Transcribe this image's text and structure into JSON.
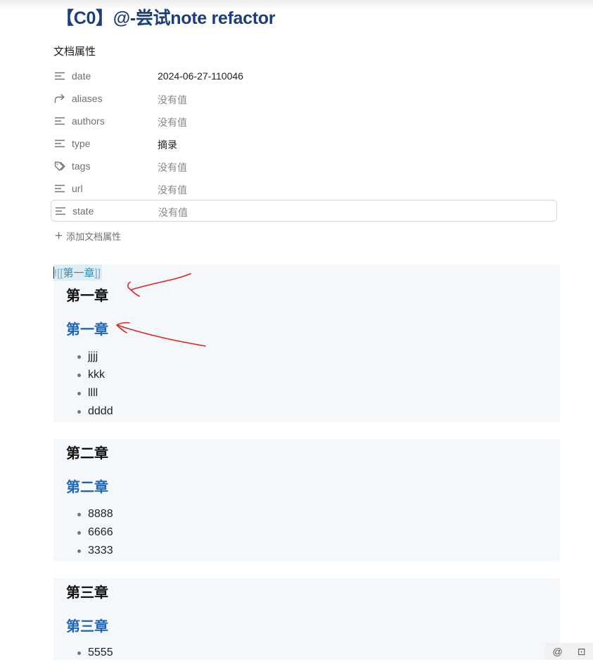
{
  "page": {
    "title": "【C0】@-尝试note refactor"
  },
  "properties": {
    "heading": "文档属性",
    "rows": [
      {
        "key": "date",
        "value": "2024-06-27-110046",
        "icon": "text-lines-icon",
        "empty": false
      },
      {
        "key": "aliases",
        "value": "没有值",
        "icon": "forward-arrow-icon",
        "empty": true
      },
      {
        "key": "authors",
        "value": "没有值",
        "icon": "text-lines-icon",
        "empty": true
      },
      {
        "key": "type",
        "value": "摘录",
        "icon": "text-lines-icon",
        "empty": false
      },
      {
        "key": "tags",
        "value": "没有值",
        "icon": "tags-icon",
        "empty": true
      },
      {
        "key": "url",
        "value": "没有值",
        "icon": "text-lines-icon",
        "empty": true
      },
      {
        "key": "state",
        "value": "没有值",
        "icon": "text-lines-icon",
        "empty": true
      }
    ],
    "add_label": "添加文档属性"
  },
  "editor": {
    "wikilink_prefix": "![[",
    "wikilink_text": "第一章",
    "wikilink_suffix": "]]"
  },
  "sections": [
    {
      "title": "第一章",
      "heading": "第一章",
      "items": [
        "jjjj",
        "kkk",
        "llll",
        "dddd"
      ]
    },
    {
      "title": "第二章",
      "heading": "第二章",
      "items": [
        "8888",
        "6666",
        "3333"
      ]
    },
    {
      "title": "第三章",
      "heading": "第三章",
      "items": [
        "5555"
      ]
    }
  ],
  "corner_tools": {
    "at_symbol": "@",
    "bot_symbol": "⊡"
  },
  "colors": {
    "title": "#1c3f7a",
    "heading_blue": "#2066b8",
    "embed_bg": "#f5f8fb",
    "annotation": "#e02424"
  }
}
